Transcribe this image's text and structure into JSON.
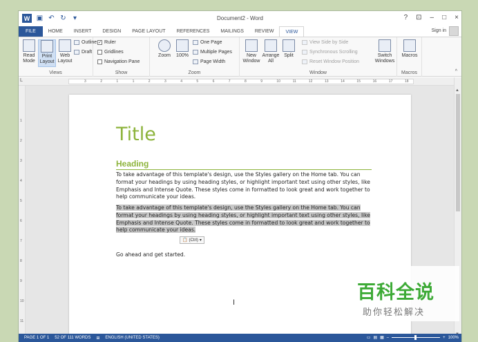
{
  "window": {
    "title": "Document2 - Word",
    "controls": [
      "?",
      "⊡",
      "–",
      "□",
      "×"
    ],
    "signin": "Sign in"
  },
  "tabs": [
    "FILE",
    "HOME",
    "INSERT",
    "DESIGN",
    "PAGE LAYOUT",
    "REFERENCES",
    "MAILINGS",
    "REVIEW",
    "VIEW"
  ],
  "ribbon": {
    "views": {
      "label": "Views",
      "read_mode": "Read Mode",
      "print_layout": "Print Layout",
      "web_layout": "Web Layout",
      "outline": "Outline",
      "draft": "Draft"
    },
    "show": {
      "label": "Show",
      "ruler": "Ruler",
      "gridlines": "Gridlines",
      "nav_pane": "Navigation Pane"
    },
    "zoom": {
      "label": "Zoom",
      "zoom": "Zoom",
      "pct": "100%",
      "one_page": "One Page",
      "multiple_pages": "Multiple Pages",
      "page_width": "Page Width"
    },
    "window": {
      "label": "Window",
      "new_window": "New Window",
      "arrange_all": "Arrange All",
      "split": "Split",
      "view_side": "View Side by Side",
      "sync_scroll": "Synchronous Scrolling",
      "reset_pos": "Reset Window Position",
      "switch_windows": "Switch Windows"
    },
    "macros": {
      "label": "Macros",
      "macros": "Macros"
    }
  },
  "ruler": [
    "3",
    "2",
    "1",
    "1",
    "2",
    "3",
    "4",
    "5",
    "6",
    "7",
    "8",
    "9",
    "10",
    "11",
    "12",
    "13",
    "14",
    "15",
    "16",
    "17",
    "18"
  ],
  "vruler": [
    "1",
    "2",
    "3",
    "4",
    "5",
    "6",
    "7",
    "8",
    "9",
    "10",
    "11",
    "12"
  ],
  "document": {
    "title": "Title",
    "heading": "Heading",
    "para1": "To take advantage of this template's design, use the Styles gallery on the Home tab. You can format your headings by using heading styles, or highlight important text using other styles, like Emphasis and Intense Quote. These styles come in formatted to look great and work together to help communicate your ideas.",
    "para2": "To take advantage of this template's design, use the Styles gallery on the Home tab. You can format your headings by using heading styles, or highlight important text using other styles, like Emphasis and Intense Quote. These styles come in formatted to look great and work together to help communicate your ideas.",
    "paste_badge": "(Ctrl)",
    "para3": "Go ahead and get started."
  },
  "status": {
    "page": "PAGE 1 OF 1",
    "words": "52 OF 111 WORDS",
    "language": "ENGLISH (UNITED STATES)",
    "zoom": "100%"
  },
  "watermark": {
    "main": "百科全说",
    "sub": "助你轻松解决"
  },
  "colors": {
    "accent": "#2b579a",
    "heading_green": "#8cb33a",
    "watermark_green": "#3daa36"
  }
}
